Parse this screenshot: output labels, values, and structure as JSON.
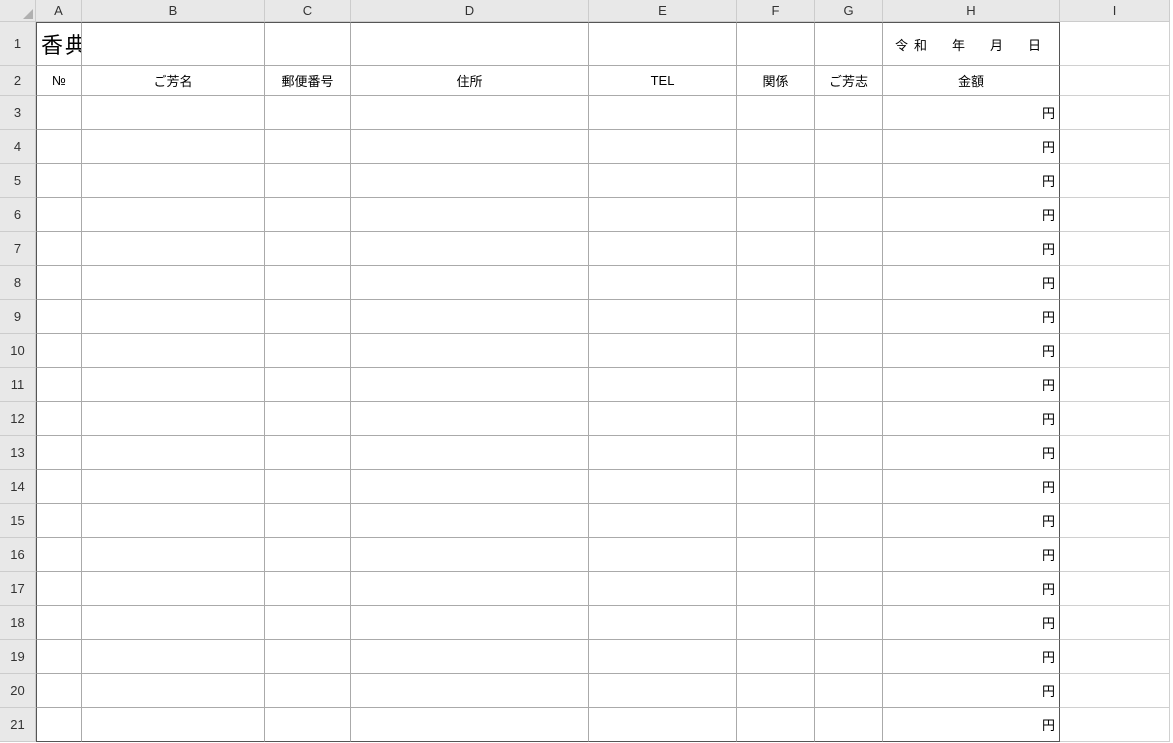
{
  "columns": [
    "A",
    "B",
    "C",
    "D",
    "E",
    "F",
    "G",
    "H",
    "I"
  ],
  "row_numbers": [
    1,
    2,
    3,
    4,
    5,
    6,
    7,
    8,
    9,
    10,
    11,
    12,
    13,
    14,
    15,
    16,
    17,
    18,
    19,
    20,
    21
  ],
  "title": "香典帳",
  "date_label": "令和　年　月　日",
  "headers": {
    "no": "№",
    "name": "ご芳名",
    "postal": "郵便番号",
    "address": "住所",
    "tel": "TEL",
    "relation": "関係",
    "gohoushi": "ご芳志",
    "amount": "金額"
  },
  "yen": "円",
  "data_row_count": 19
}
